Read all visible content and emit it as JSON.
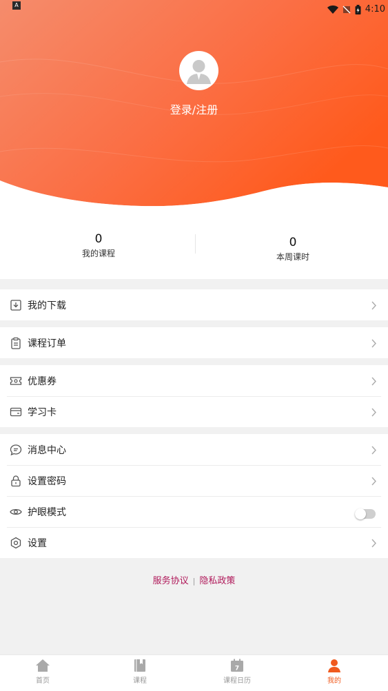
{
  "status_bar": {
    "left_badge": "A",
    "time": "4:10"
  },
  "profile": {
    "login_label": "登录/注册"
  },
  "stats": [
    {
      "value": "0",
      "label": "我的课程"
    },
    {
      "value": "0",
      "label": "本周课时"
    }
  ],
  "menu": {
    "download": "我的下载",
    "orders": "课程订单",
    "coupons": "优惠券",
    "study_card": "学习卡",
    "messages": "消息中心",
    "set_password": "设置密码",
    "eye_mode": "护眼模式",
    "eye_mode_on": false,
    "settings": "设置"
  },
  "footer": {
    "service_agreement": "服务协议",
    "separator": "|",
    "privacy_policy": "隐私政策"
  },
  "tabbar": [
    {
      "label": "首页",
      "icon": "home-icon"
    },
    {
      "label": "课程",
      "icon": "book-icon"
    },
    {
      "label": "课程日历",
      "icon": "calendar-icon",
      "day": "7"
    },
    {
      "label": "我的",
      "icon": "user-icon",
      "active": true
    }
  ],
  "colors": {
    "accent": "#f05a1e",
    "link": "#b0195a",
    "hero_start": "#f58a6a",
    "hero_end": "#fe5a1e"
  }
}
